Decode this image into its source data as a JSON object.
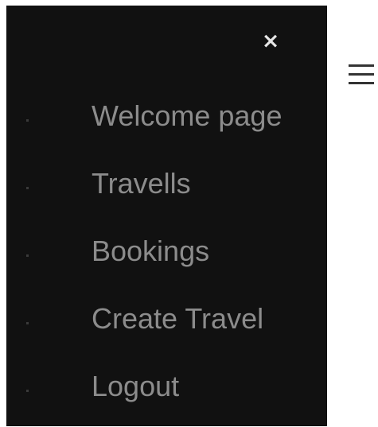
{
  "sidenav": {
    "close_icon": "×",
    "items": [
      {
        "label": "Welcome page"
      },
      {
        "label": "Travells"
      },
      {
        "label": "Bookings"
      },
      {
        "label": "Create Travel"
      },
      {
        "label": "Logout"
      }
    ]
  },
  "header": {
    "menu_icon": "hamburger-icon"
  },
  "colors": {
    "sidenav_background": "#111111",
    "menu_text": "#8c8c8c",
    "close_icon": "#e6e6e6",
    "hamburger": "#333333"
  }
}
